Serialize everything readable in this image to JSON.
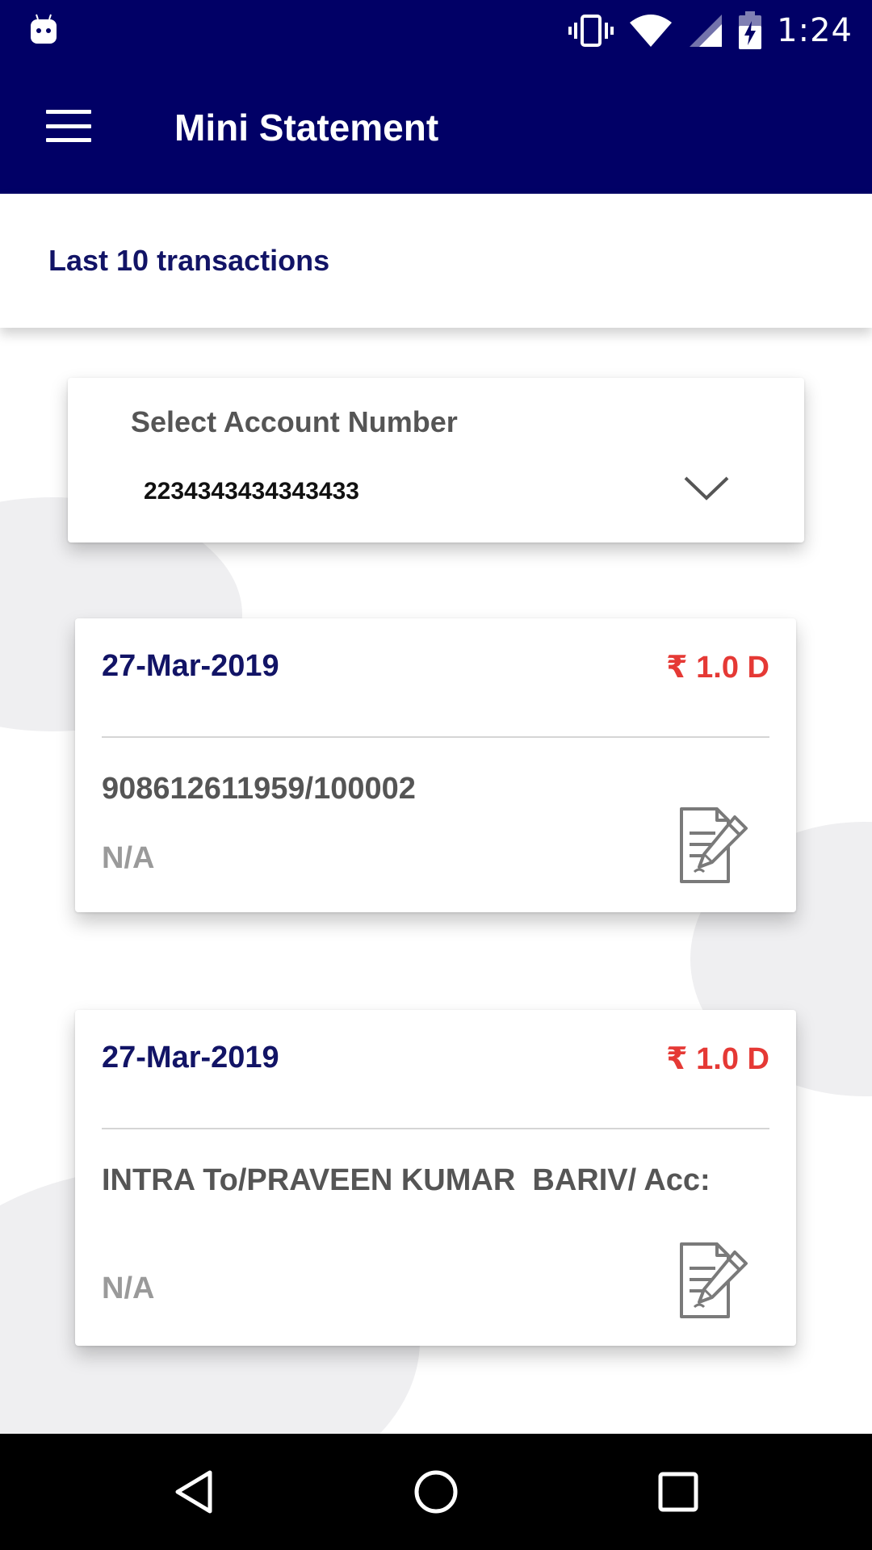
{
  "status_bar": {
    "time": "1:24"
  },
  "app_bar": {
    "title": "Mini Statement"
  },
  "subheader": {
    "text": "Last 10 transactions"
  },
  "account_selector": {
    "label": "Select Account Number",
    "value": "2234343434343433"
  },
  "transactions": [
    {
      "date": "27-Mar-2019",
      "amount": "₹ 1.0 D",
      "description": "908612611959/100002",
      "remark": "N/A"
    },
    {
      "date": "27-Mar-2019",
      "amount": "₹ 1.0 D",
      "description": "INTRA To/PRAVEEN KUMAR  BARIV/ Acc:",
      "remark": "N/A"
    }
  ],
  "icons": {
    "menu": "hamburger-menu-icon",
    "dropdown": "chevron-down-icon",
    "note": "note-edit-icon",
    "back": "back-triangle-icon",
    "home": "home-circle-icon",
    "recents": "recents-square-icon"
  },
  "colors": {
    "primary": "#010066",
    "title_text": "#121466",
    "debit_amount": "#e53935",
    "secondary_text": "#555555",
    "muted_text": "#9a9a9a"
  }
}
